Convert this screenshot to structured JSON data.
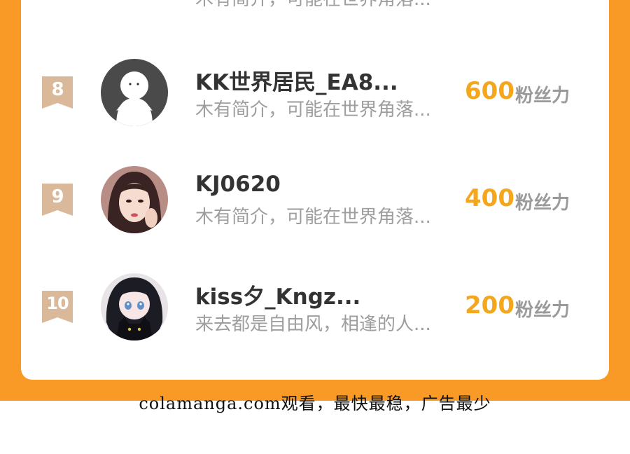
{
  "leaderboard": {
    "top_partial": {
      "bio": "木有简介，可能在世界角落..."
    },
    "rows": [
      {
        "rank": "8",
        "name": "KK世界居民_EA8...",
        "bio": "木有简介，可能在世界角落...",
        "score": "600",
        "unit": "粉丝力",
        "avatar": "default-person-avatar"
      },
      {
        "rank": "9",
        "name": "KJ0620",
        "bio": "木有简介，可能在世界角落...",
        "score": "400",
        "unit": "粉丝力",
        "avatar": "portrait-avatar"
      },
      {
        "rank": "10",
        "name": "kiss夕_Kngz...",
        "bio": "来去都是自由风，相逢的人...",
        "score": "200",
        "unit": "粉丝力",
        "avatar": "anime-girl-cat-avatar"
      }
    ]
  },
  "footer": {
    "watermark": "colamanga.com观看，最快最稳，广告最少"
  },
  "colors": {
    "accent_orange": "#fa9a26",
    "score_gold": "#f4a71c",
    "rank_badge": "#d9b99a"
  }
}
